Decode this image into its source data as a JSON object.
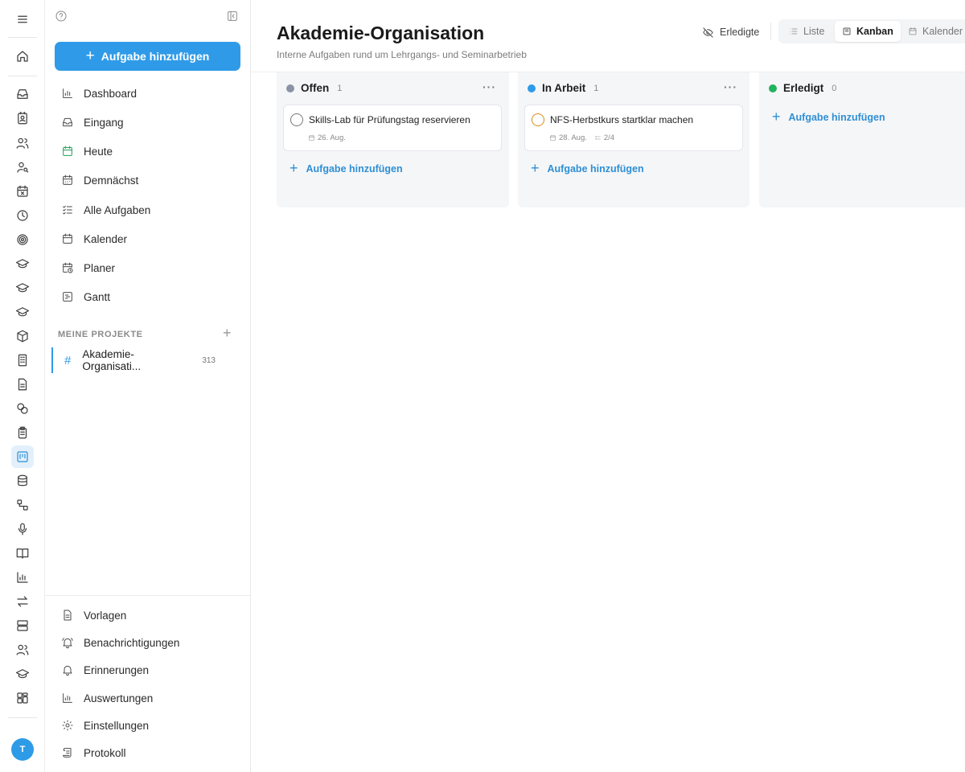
{
  "rail": {
    "icons": [
      "menu-icon",
      "home-icon",
      "inbox-icon",
      "contact-card-icon",
      "users-icon",
      "user-search-icon",
      "calendar-x-icon",
      "clock-icon",
      "target-icon",
      "graduation-cap-icon",
      "graduation-cap-icon",
      "graduation-cap-icon",
      "package-icon",
      "building-icon",
      "document-icon",
      "coins-icon",
      "clipboard-icon",
      "kanban-icon",
      "database-icon",
      "workflow-icon",
      "microphone-icon",
      "book-icon",
      "bar-chart-icon",
      "transfer-icon",
      "server-icon",
      "users-icon",
      "graduation-cap-icon",
      "apps-grid-icon"
    ],
    "active_index": 17,
    "avatar_initial": "T",
    "accent": "#2b8fd6"
  },
  "sidebar": {
    "add_task_label": "Aufgabe hinzufügen",
    "nav": [
      {
        "label": "Dashboard",
        "icon": "bar-chart-icon"
      },
      {
        "label": "Eingang",
        "icon": "inbox-icon"
      },
      {
        "label": "Heute",
        "icon": "calendar-today-icon"
      },
      {
        "label": "Demnächst",
        "icon": "calendar-grid-icon"
      },
      {
        "label": "Alle Aufgaben",
        "icon": "checklist-icon"
      },
      {
        "label": "Kalender",
        "icon": "calendar-icon"
      },
      {
        "label": "Planer",
        "icon": "calendar-clock-icon"
      },
      {
        "label": "Gantt",
        "icon": "gantt-icon"
      }
    ],
    "projects_section_label": "MEINE PROJEKTE",
    "project": {
      "name": "Akademie-Organisati...",
      "count": "313"
    },
    "bottom_nav": [
      {
        "label": "Vorlagen",
        "icon": "template-icon"
      },
      {
        "label": "Benachrichtigungen",
        "icon": "bell-ring-icon"
      },
      {
        "label": "Erinnerungen",
        "icon": "bell-icon"
      },
      {
        "label": "Auswertungen",
        "icon": "bar-chart-icon"
      },
      {
        "label": "Einstellungen",
        "icon": "gear-icon"
      },
      {
        "label": "Protokoll",
        "icon": "scroll-icon"
      }
    ]
  },
  "header": {
    "title": "Akademie-Organisation",
    "subtitle": "Interne Aufgaben rund um Lehrgangs- und Seminarbetrieb",
    "done_toggle_label": "Erledigte",
    "views": [
      {
        "label": "Liste",
        "icon": "list-icon"
      },
      {
        "label": "Kanban",
        "icon": "kanban-icon"
      },
      {
        "label": "Kalender",
        "icon": "calendar-icon"
      }
    ],
    "active_view": "Kanban"
  },
  "board": {
    "add_label": "Aufgabe hinzufügen",
    "columns": [
      {
        "title": "Offen",
        "count": "1",
        "color": "#8a94a6",
        "cards": [
          {
            "title": "Skills-Lab für Prüfungstag reservieren",
            "date": "26. Aug.",
            "subtasks": "",
            "status_color": "#777777"
          }
        ]
      },
      {
        "title": "In Arbeit",
        "count": "1",
        "color": "#2f9be8",
        "cards": [
          {
            "title": "NFS-Herbstkurs startklar machen",
            "date": "28. Aug.",
            "subtasks": "2/4",
            "status_color": "#e08a1e"
          }
        ]
      },
      {
        "title": "Erledigt",
        "count": "0",
        "color": "#22b35e",
        "cards": []
      }
    ]
  }
}
